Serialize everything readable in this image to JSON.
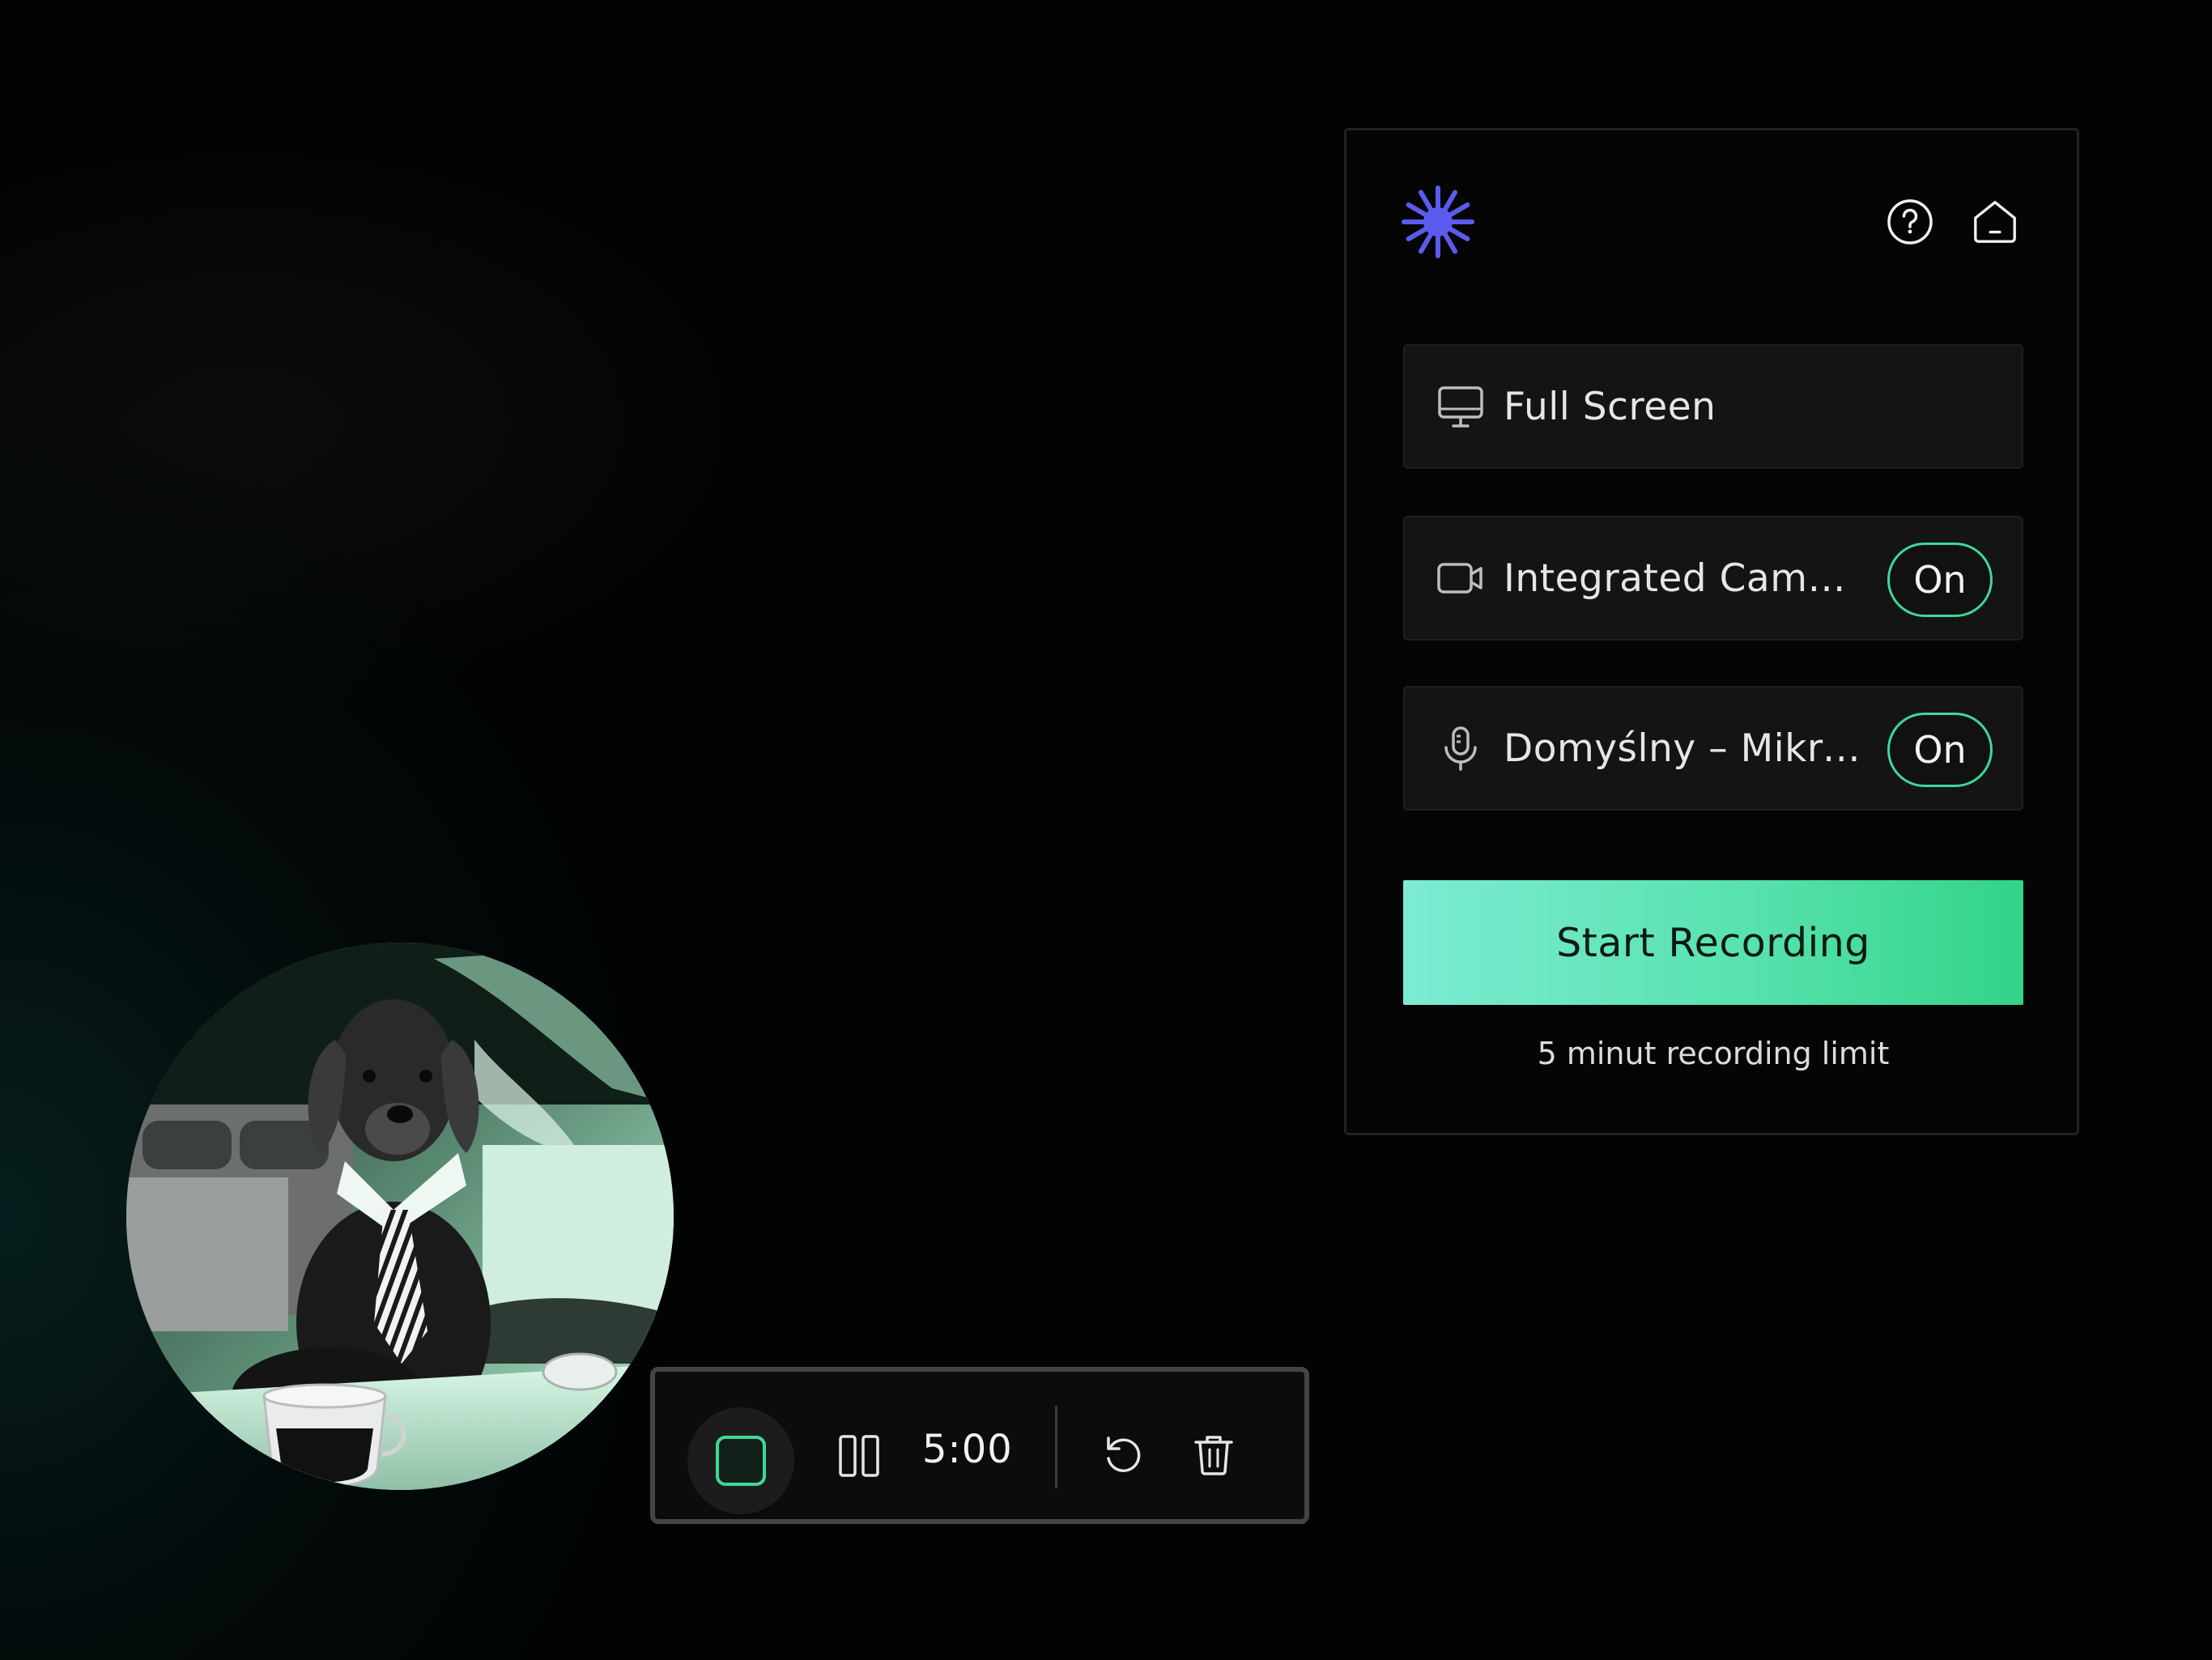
{
  "colors": {
    "accent": "#3fd898",
    "brand_logo": "#5b5bf0",
    "button_gradient": [
      "#7cebd3",
      "#33d388"
    ],
    "panel_bg": "#050505",
    "row_bg": "#141414"
  },
  "header": {
    "logo_icon": "asterisk-logo-icon",
    "help_icon": "question-circle-icon",
    "home_icon": "home-icon"
  },
  "recorder": {
    "screen_source": {
      "icon": "monitor-icon",
      "label": "Full Screen"
    },
    "camera": {
      "icon": "video-camera-icon",
      "label": "Integrated Camera",
      "toggle": "On"
    },
    "microphone": {
      "icon": "microphone-icon",
      "label": "Domyślny – Mikrofon",
      "toggle": "On"
    },
    "start_button": "Start Recording",
    "limit_note": "5 minut recording limit"
  },
  "camera_preview": {
    "description_icon": "webcam-preview-image"
  },
  "controls": {
    "stop_icon": "stop-icon",
    "pause_icon": "pause-icon",
    "timer": "5:00",
    "restart_icon": "restart-icon",
    "delete_icon": "trash-icon"
  }
}
